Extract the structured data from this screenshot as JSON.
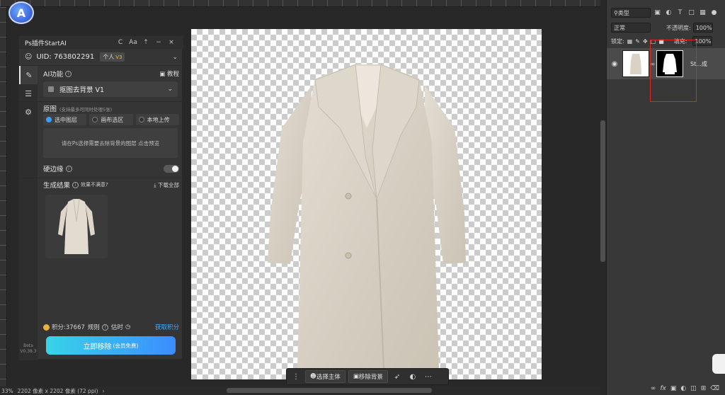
{
  "app": {
    "logo_letter": "A"
  },
  "plugin": {
    "title": "Ps插件StartAI",
    "refresh": "C",
    "font_size": "Aa",
    "pin": "⇡",
    "minimize": "−",
    "close": "×",
    "uid": "UID: 763802291",
    "level": "个人",
    "level_tag": "V3",
    "ai_title": "AI功能",
    "tutorial": "教程",
    "function_value": "抠图去背景 V1",
    "source_title": "原图",
    "source_sub": "(支持最多可同时处理5张)",
    "options": [
      "选中图层",
      "画布选区",
      "本地上传"
    ],
    "preview_hint": "请在Ps选择需要去除背景的图层 点击预览",
    "hard_edge": "硬边缘",
    "result_title": "生成结果",
    "result_note": "效果不满意?",
    "download_all": "下载全部",
    "points": "积分:37667",
    "points_rule": "规则",
    "history": "估时",
    "earn": "获取积分",
    "remove_btn": "立即移除",
    "remove_sub": "(会员免费)",
    "beta": "Beta\nV0.38.3"
  },
  "toolbar": {
    "select_subject": "选择主体",
    "remove_bg": "移除背景"
  },
  "status": {
    "zoom": "33%",
    "doc_size": "2202 像素 x 2202 像素 (72 ppi)"
  },
  "layers": {
    "kind": "类型",
    "blend": "正常",
    "opacity_label": "不透明度:",
    "opacity": "100%",
    "lock_label": "锁定:",
    "fill_label": "填充:",
    "fill": "100%",
    "layer_name": "St...成"
  },
  "colors": {
    "accent": "#3aa0ff",
    "highlight_frame": "#e0261f",
    "button_start": "#38d4e8",
    "button_end": "#3b8dff"
  }
}
